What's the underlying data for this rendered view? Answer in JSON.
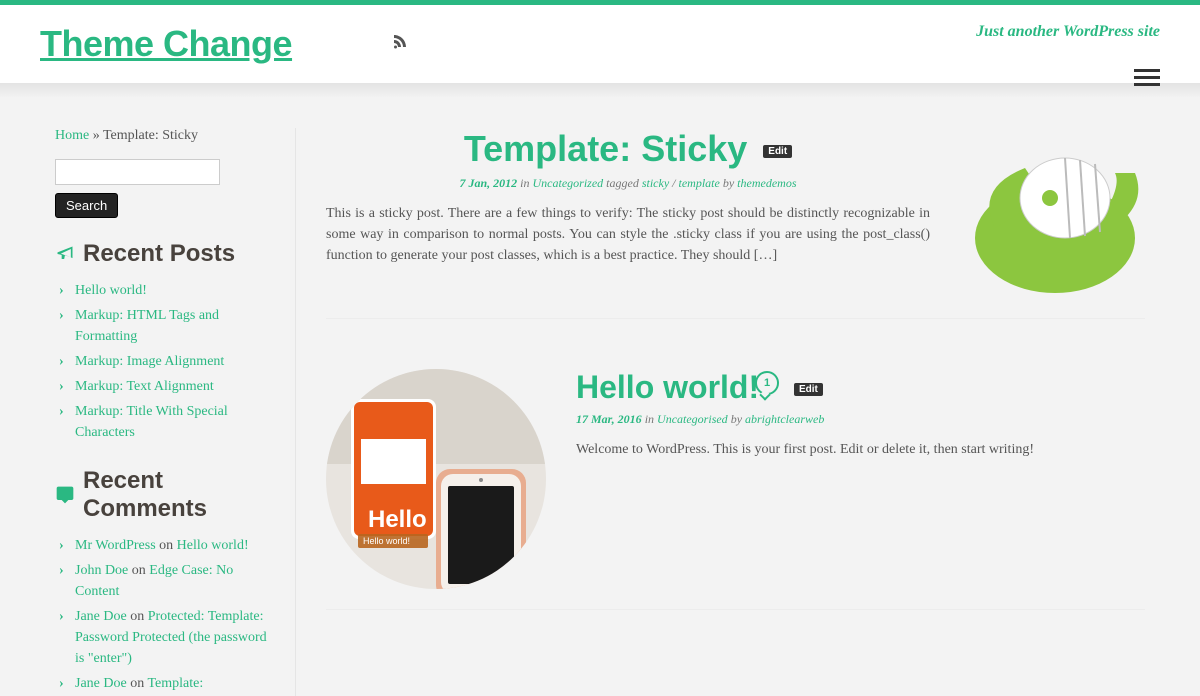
{
  "header": {
    "site_title": "Theme Change",
    "tagline": "Just another WordPress site"
  },
  "breadcrumb": {
    "home": "Home",
    "sep": " » ",
    "current": "Template: Sticky"
  },
  "search": {
    "button": "Search"
  },
  "sidebar": {
    "recent_posts_title": "Recent Posts",
    "recent_posts": [
      "Hello world!",
      "Markup: HTML Tags and Formatting",
      "Markup: Image Alignment",
      "Markup: Text Alignment",
      "Markup: Title With Special Characters"
    ],
    "recent_comments_title": "Recent Comments",
    "recent_comments": [
      {
        "author": "Mr WordPress",
        "on": " on ",
        "post": "Hello world!"
      },
      {
        "author": "John Doe",
        "on": " on ",
        "post": "Edge Case: No Content"
      },
      {
        "author": "Jane Doe",
        "on": " on ",
        "post": "Protected: Template: Password Protected (the password is \"enter\")"
      },
      {
        "author": "Jane Doe",
        "on": " on ",
        "post": "Template:"
      }
    ]
  },
  "posts": {
    "sticky": {
      "title": "Template: Sticky",
      "edit": "Edit",
      "date": "7 Jan, 2012",
      "in": "  in ",
      "category": "Uncategorized",
      "tagged": "  tagged ",
      "tag1": "sticky",
      "slash": " / ",
      "tag2": "template",
      "by": " by ",
      "author": "themedemos",
      "excerpt": "This is a sticky post. There are a few things to verify: The sticky post should be distinctly recognizable in some way in comparison to normal posts. You can style the .sticky class if you are using the post_class() function to generate your post classes, which is a best practice. They should […]"
    },
    "hello": {
      "title": "Hello world!",
      "edit": "Edit",
      "comment_count": "1",
      "date": "17 Mar, 2016",
      "in": "  in ",
      "category": "Uncategorised",
      "by": " by ",
      "author": "abrightclearweb",
      "excerpt": "Welcome to WordPress. This is your first post. Edit or delete it, then start writing!",
      "thumb_label": "Hello world!"
    }
  }
}
